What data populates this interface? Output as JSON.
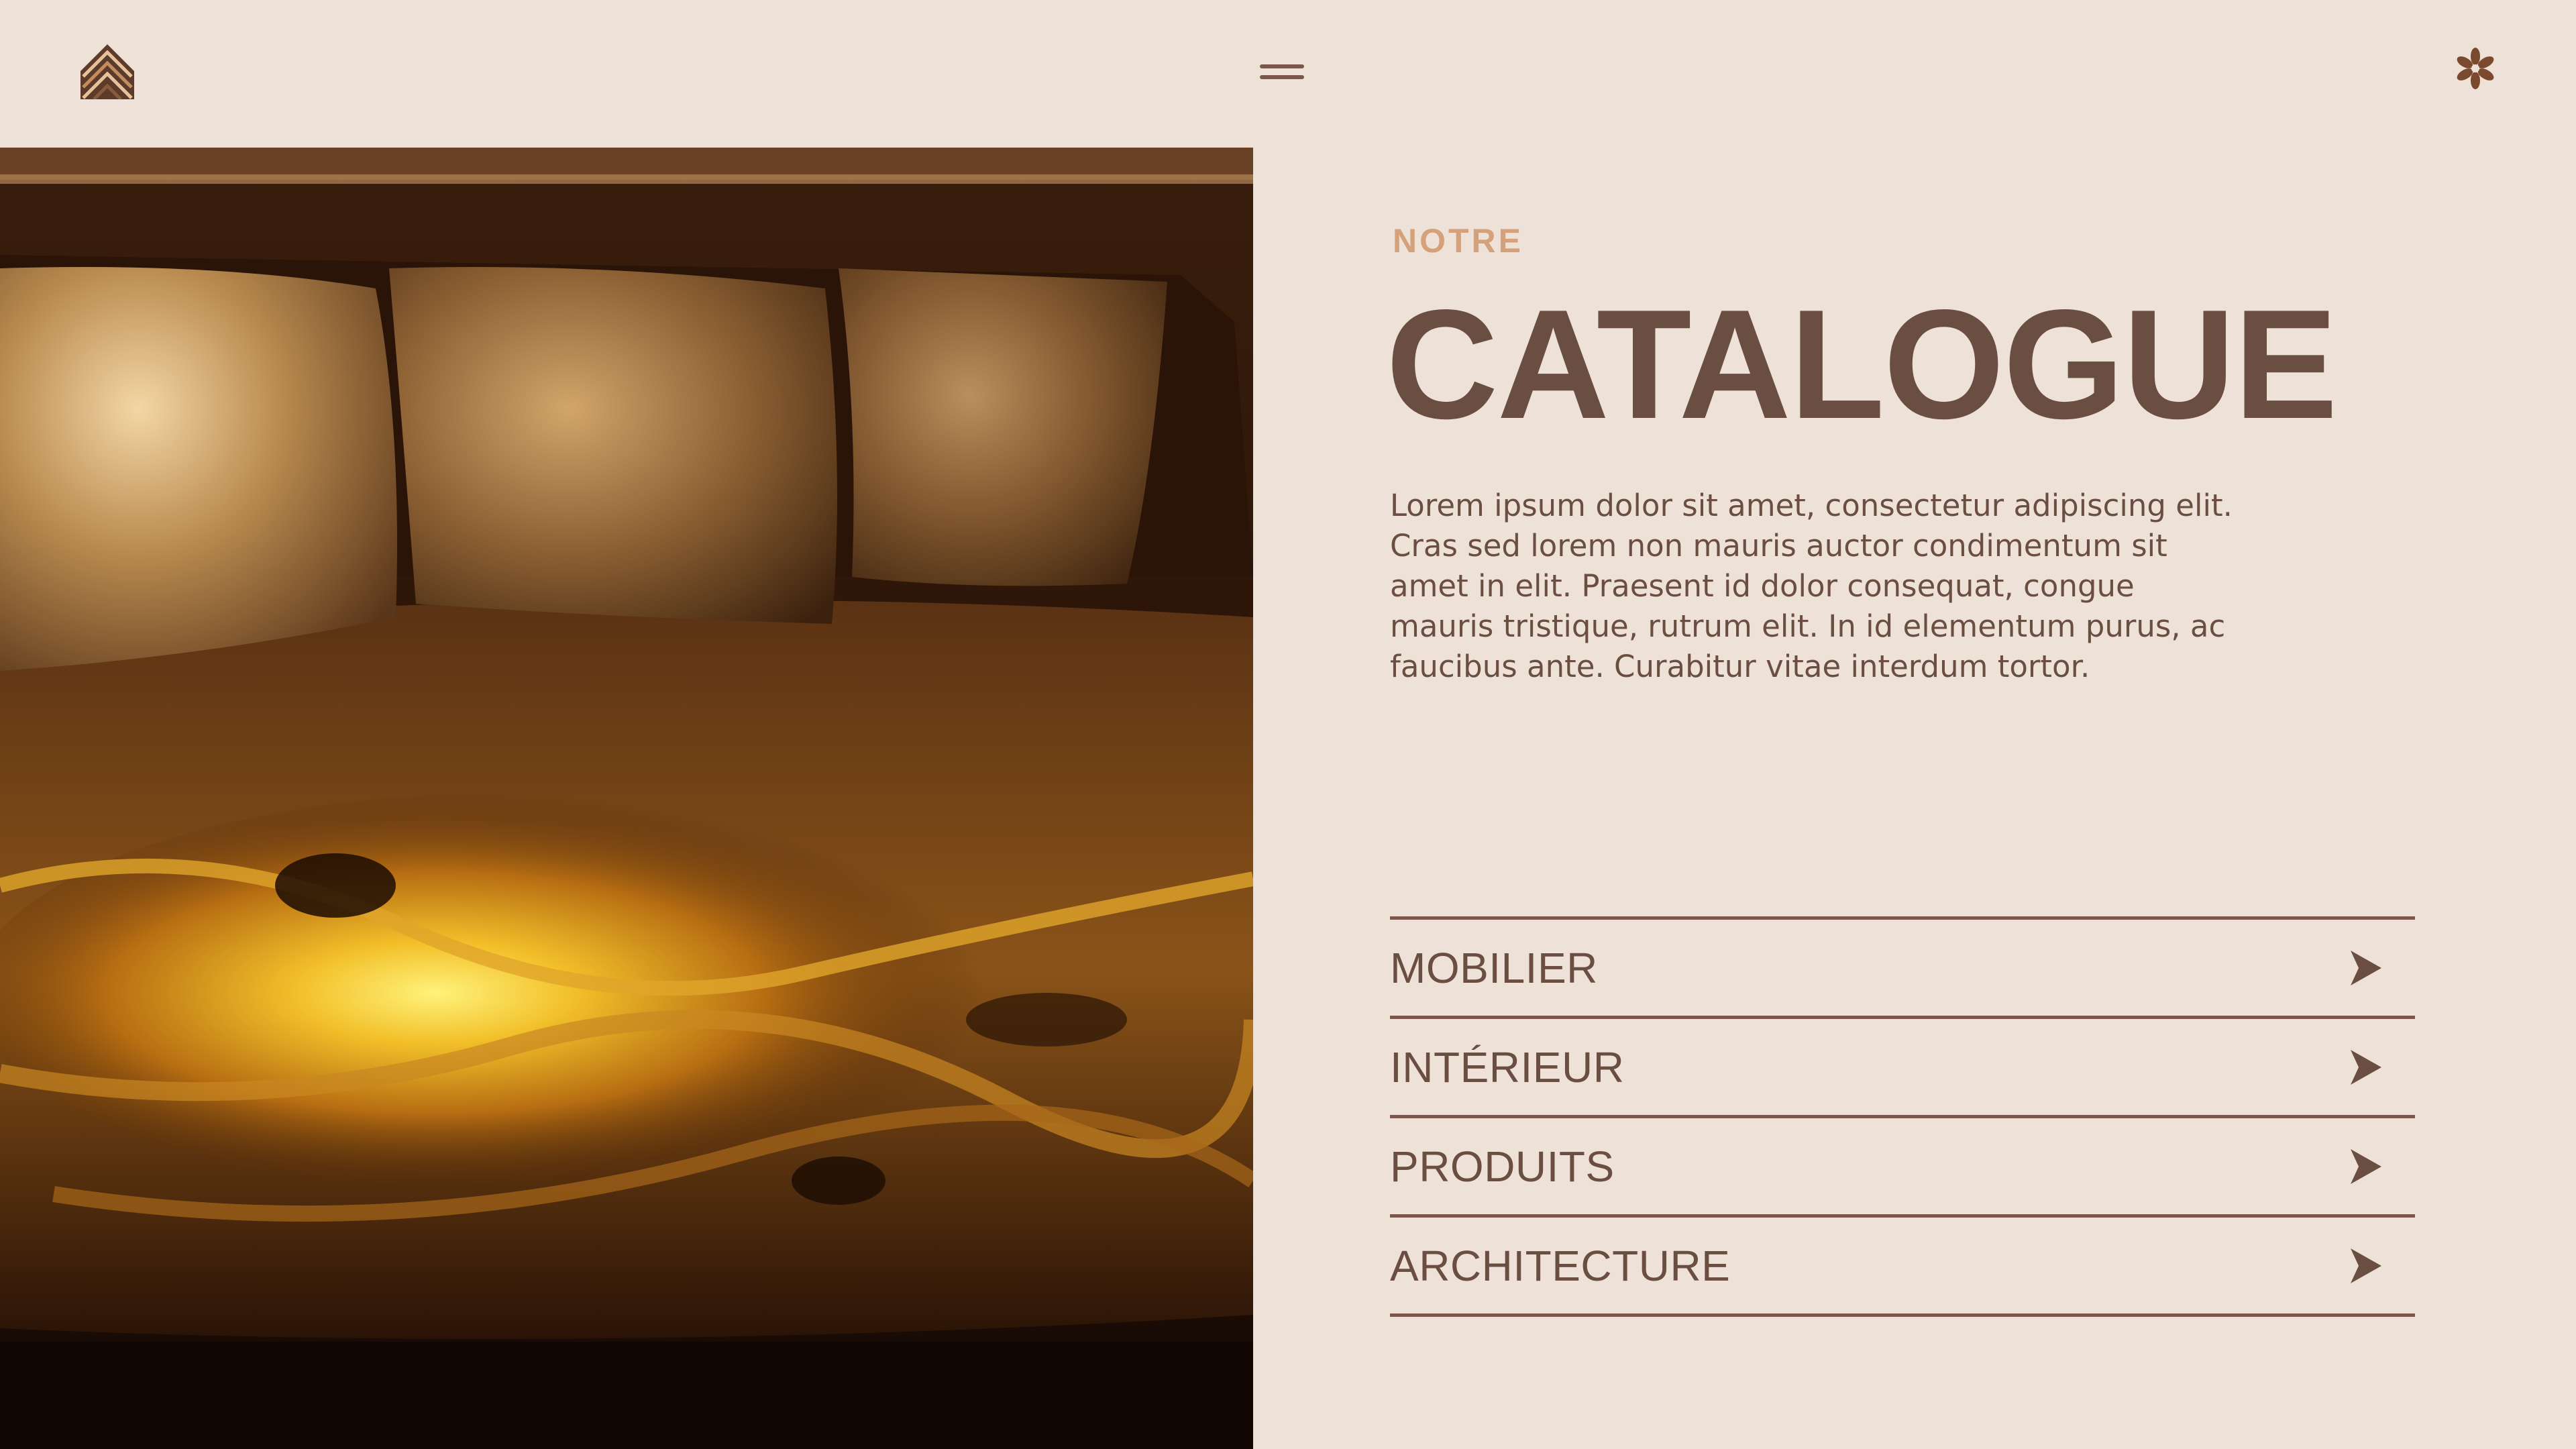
{
  "header": {
    "logo_icon": "chevron-stack-logo",
    "menu_icon": "hamburger-menu-icon",
    "flower_icon": "asterisk-flower-icon"
  },
  "hero": {
    "image_subject": "golden marbled wood sofa with pillows"
  },
  "main": {
    "eyebrow": "NOTRE",
    "title": "CATALOGUE",
    "description": "Lorem ipsum dolor sit amet, consectetur adipiscing elit. Cras sed lorem non mauris auctor condimentum sit amet in elit. Praesent id dolor consequat, congue mauris tristique, rutrum elit. In id elementum purus, ac faucibus ante. Curabitur vitae interdum tortor."
  },
  "menu": {
    "items": [
      {
        "label": "MOBILIER",
        "icon": "play-arrow-icon"
      },
      {
        "label": "INTÉRIEUR",
        "icon": "play-arrow-icon"
      },
      {
        "label": "PRODUITS",
        "icon": "play-arrow-icon"
      },
      {
        "label": "ARCHITECTURE",
        "icon": "play-arrow-icon"
      }
    ]
  },
  "colors": {
    "background": "#EEE1D8",
    "primary_brown": "#6B4E42",
    "accent_tan": "#D4A17A",
    "line_brown": "#7A574A"
  }
}
